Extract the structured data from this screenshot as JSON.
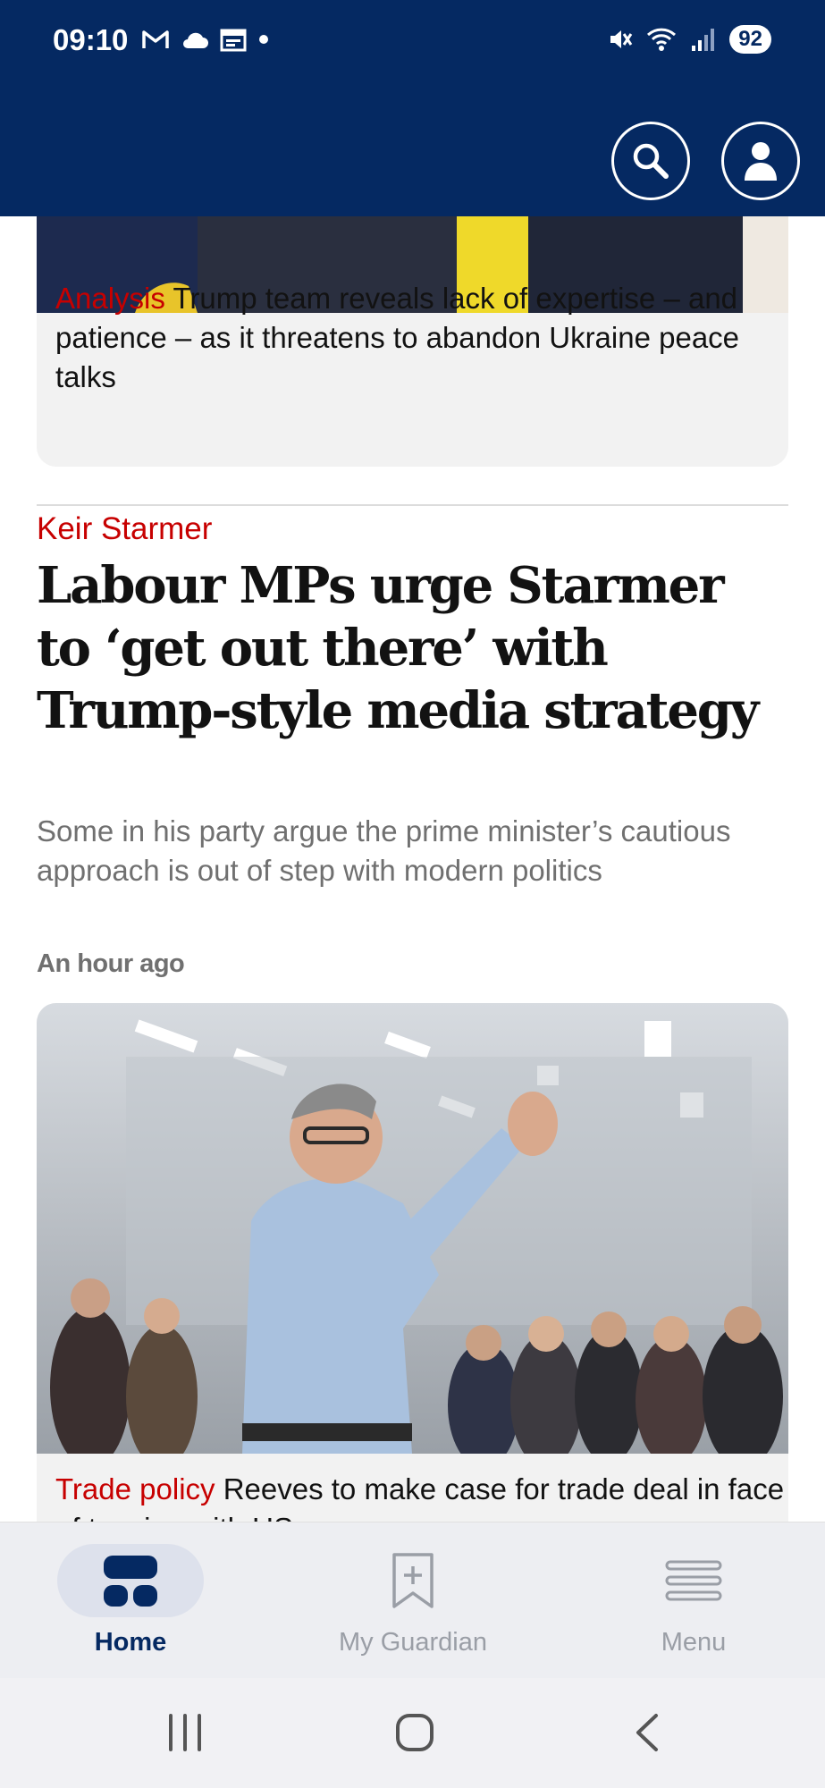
{
  "status_bar": {
    "time": "09:10",
    "left_icons": [
      "gmail-icon",
      "cloud-icon",
      "calendar-icon",
      "dot-icon"
    ],
    "right_icons": [
      "mute-icon",
      "wifi-icon",
      "signal-icon"
    ],
    "battery": "92"
  },
  "header": {
    "search_icon": "search-icon",
    "account_icon": "account-icon",
    "background_color": "#052962"
  },
  "cards": {
    "top_story": {
      "kicker": "Analysis",
      "text": "Trump team reveals lack of expertise – and patience – as it threatens to abandon Ukraine peace talks"
    },
    "main_story": {
      "section": "Keir Starmer",
      "headline": "Labour MPs urge Starmer to ‘get out there’ with Trump-style media strategy",
      "standfirst": "Some in his party argue the prime minister’s cautious approach is out of step with modern politics",
      "timestamp": "An hour ago"
    },
    "next_story": {
      "kicker": "Trade policy",
      "text": "Reeves to make case for trade deal in face of tension with US"
    }
  },
  "bottom_nav": {
    "items": [
      {
        "label": "Home",
        "icon": "home-grid-icon",
        "active": true
      },
      {
        "label": "My Guardian",
        "icon": "bookmark-plus-icon",
        "active": false
      },
      {
        "label": "Menu",
        "icon": "menu-icon",
        "active": false
      }
    ]
  },
  "system_nav": {
    "icons": [
      "recent-apps-icon",
      "home-icon",
      "back-icon"
    ]
  },
  "colors": {
    "brand_blue": "#052962",
    "kicker_red": "#c70000",
    "muted_gray": "#707070"
  }
}
